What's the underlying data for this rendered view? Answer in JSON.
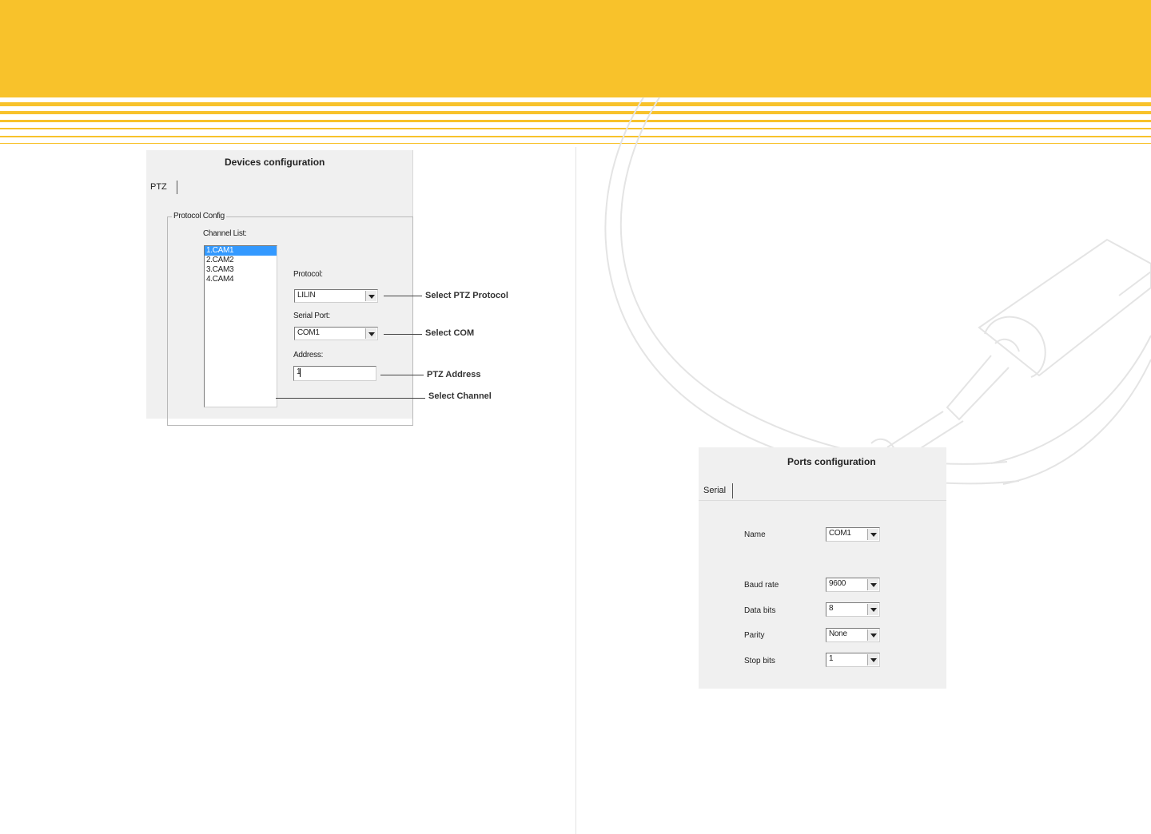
{
  "colors": {
    "accent": "#f8c22b",
    "selection": "#3399ff"
  },
  "devices_config": {
    "title": "Devices configuration",
    "tab": "PTZ",
    "group_title": "Protocol Config",
    "channel_list_label": "Channel List:",
    "channels": [
      "1.CAM1",
      "2.CAM2",
      "3.CAM3",
      "4.CAM4"
    ],
    "selected_channel": "1.CAM1",
    "protocol_label": "Protocol:",
    "protocol_value": "LILIN",
    "serial_port_label": "Serial Port:",
    "serial_port_value": "COM1",
    "address_label": "Address:",
    "address_value": "1",
    "callouts": {
      "protocol": "Select PTZ Protocol",
      "com": "Select COM",
      "address": "PTZ Address",
      "channel": "Select Channel"
    }
  },
  "ports_config": {
    "title": "Ports configuration",
    "tab": "Serial",
    "fields": {
      "name": {
        "label": "Name",
        "value": "COM1"
      },
      "baud_rate": {
        "label": "Baud rate",
        "value": "9600"
      },
      "data_bits": {
        "label": "Data bits",
        "value": "8"
      },
      "parity": {
        "label": "Parity",
        "value": "None"
      },
      "stop_bits": {
        "label": "Stop bits",
        "value": "1"
      }
    }
  },
  "icons": {
    "dropdown": "chevron-down-icon"
  }
}
